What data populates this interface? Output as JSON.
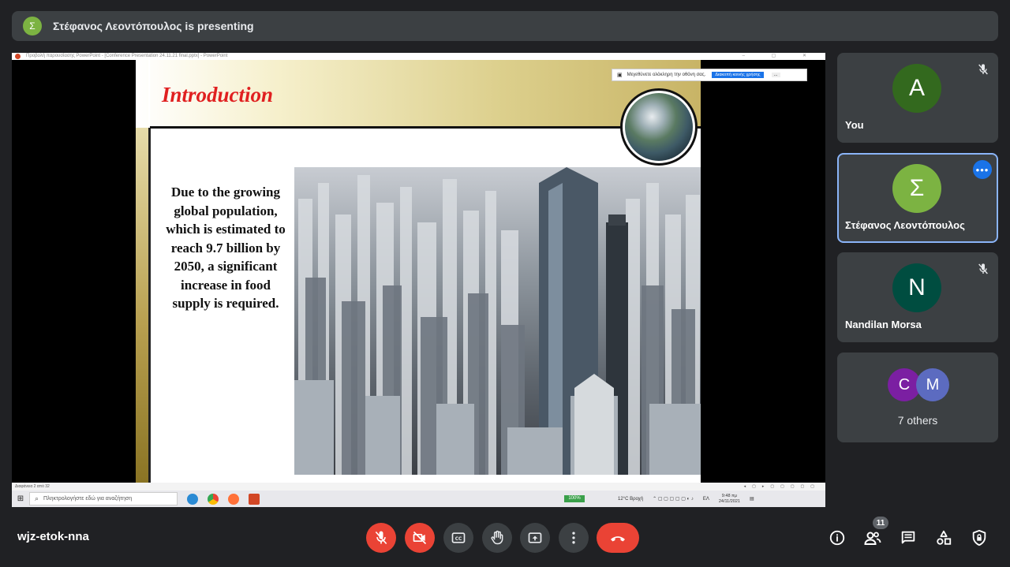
{
  "presenting": {
    "avatar_letter": "Σ",
    "text": "Στέφανος Λεοντόπουλος is presenting"
  },
  "shared_screen": {
    "window_title": "Προβολή παρουσίασης PowerPoint - [Conference Presentation 24.11.21 final.pptx] - PowerPoint",
    "fullscreen_notice": {
      "text": "Μεγεθύνετε ολόκληρη την οθόνη σας.",
      "button": "Διακοπή κοινής χρήσης",
      "more": "..."
    },
    "slide": {
      "title": "Introduction",
      "body": "Due to the growing global population, which is estimated to reach 9.7 billion by 2050, a significant increase in food supply is required."
    },
    "status_text": "Διαφάνεια 2 από 32",
    "taskbar": {
      "search_placeholder": "Πληκτρολογήστε εδώ για αναζήτηση",
      "battery": "100%",
      "weather": "12°C Βροχή",
      "language": "ΕΛ",
      "time": "9:48 πμ",
      "date": "24/11/2021"
    }
  },
  "participants": [
    {
      "name": "You",
      "initial": "A",
      "color": "#33691e",
      "muted": true
    },
    {
      "name": "Στέφανος Λεοντόπουλος",
      "initial": "Σ",
      "color": "#7cb342",
      "active": true
    },
    {
      "name": "Nandilan Morsa",
      "initial": "N",
      "color": "#004d40",
      "muted": true
    }
  ],
  "others": {
    "avatars": [
      {
        "initial": "C",
        "color": "#7b1fa2"
      },
      {
        "initial": "M",
        "color": "#5c6bc0"
      }
    ],
    "label": "7 others"
  },
  "meeting": {
    "code": "wjz-etok-nna",
    "people_count": "11"
  },
  "controls": [
    "microphone-off",
    "camera-off",
    "captions",
    "raise-hand",
    "present-screen",
    "more-options",
    "leave-call"
  ],
  "side_controls": [
    "meeting-details",
    "people",
    "chat",
    "activities",
    "host-controls"
  ]
}
